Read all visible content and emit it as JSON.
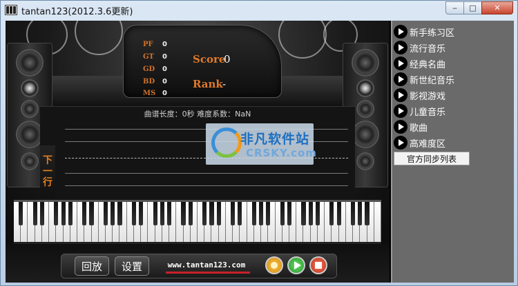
{
  "window": {
    "title": "tantan123(2012.3.6更新)",
    "minimize_glyph": "‒",
    "maximize_glyph": "□",
    "close_glyph": "✕"
  },
  "scoreboard": {
    "stats": [
      {
        "label": "PF",
        "value": "0"
      },
      {
        "label": "GT",
        "value": "0"
      },
      {
        "label": "GD",
        "value": "0"
      },
      {
        "label": "BD",
        "value": "0"
      },
      {
        "label": "MS",
        "value": "0"
      }
    ],
    "score_label": "Score",
    "score_value": "0",
    "rank_label": "Rank",
    "rank_value": "-"
  },
  "sheet": {
    "info": "曲谱长度：0秒  难度系数：NaN",
    "next_line_label": [
      "下",
      "一",
      "行"
    ]
  },
  "watermark": {
    "cn": "非凡软件站",
    "en": "CRSKY.com"
  },
  "controls": {
    "replay_label": "回放",
    "settings_label": "设置",
    "site": "www.tantan123.com"
  },
  "sidebar": {
    "items": [
      {
        "label": "新手练习区"
      },
      {
        "label": "流行音乐"
      },
      {
        "label": "经典名曲"
      },
      {
        "label": "新世纪音乐"
      },
      {
        "label": "影视游戏"
      },
      {
        "label": "儿童音乐"
      },
      {
        "label": "歌曲"
      },
      {
        "label": "高难度区"
      }
    ],
    "official_sync_label": "官方同步列表"
  },
  "colors": {
    "accent_orange": "#e07a2a",
    "sidebar_bg": "#6a6a6a",
    "play_green": "#1f9a2a",
    "stop_red": "#c0301c"
  }
}
